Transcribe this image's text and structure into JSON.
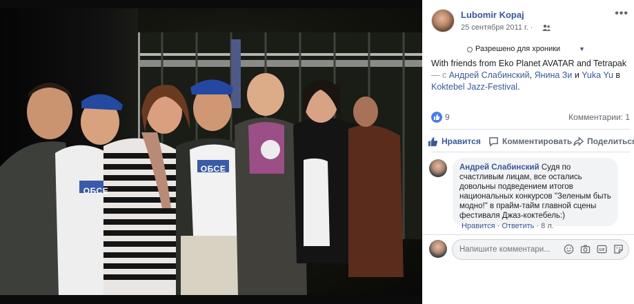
{
  "post": {
    "author": "Lubomir Kopaj",
    "date": "25 сентября 2011 г.",
    "date_separator": "·",
    "privacy": "Разрешено для хроники",
    "more_menu": "•••",
    "text": {
      "intro": "With friends from Eko Planet AVATAR and Tetrapak",
      "dash": " — с ",
      "friend_1": "Андрей Слабинский",
      "comma": ", ",
      "friend_2": "Янина Зи",
      "and": " и ",
      "friend_3": "Yuka Yu",
      "in": " в ",
      "place": "Koktebel Jazz-Festival",
      "end": "."
    },
    "likes_count": "9",
    "comments_count": "Комментарии: 1"
  },
  "actions": {
    "like": "Нравится",
    "comment": "Комментировать",
    "share": "Поделиться"
  },
  "comment": {
    "author": "Андрей Слабинский",
    "text": " Судя по счастливым лицам, все остались довольны подведением итогов национальных конкурсов \"Зеленым быть модно!\" в прайм-тайм главной сцены фестиваля Джаз-коктебель:)",
    "like": "Нравится",
    "reply": "Ответить",
    "separator": "·",
    "age": "8 л."
  },
  "composer": {
    "placeholder": "Напишите комментари..."
  },
  "photo": {
    "shirt_text_1": "ОБСЕ",
    "shirt_text_2": "ОБСЕ"
  },
  "colors": {
    "link": "#385898",
    "like_blue": "#4a7cf0",
    "bubble": "#f2f3f5"
  },
  "icons": [
    "group-icon",
    "like-icon",
    "comment-icon",
    "share-icon",
    "emoji-icon",
    "camera-icon",
    "gif-icon",
    "sticker-icon"
  ]
}
